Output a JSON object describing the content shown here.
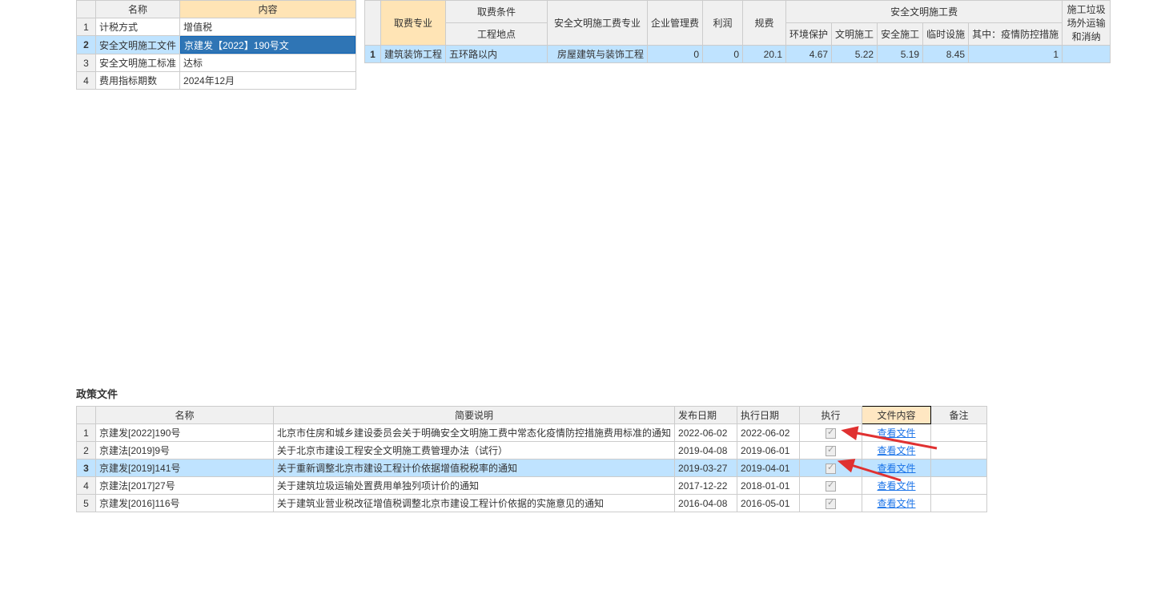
{
  "left_table": {
    "headers": {
      "name": "名称",
      "content": "内容"
    },
    "rows": [
      {
        "idx": "1",
        "name": "计税方式",
        "content": "增值税"
      },
      {
        "idx": "2",
        "name": "安全文明施工文件",
        "content": "京建发【2022】190号文",
        "selected": true,
        "editing": true
      },
      {
        "idx": "3",
        "name": "安全文明施工标准",
        "content": "达标"
      },
      {
        "idx": "4",
        "name": "费用指标期数",
        "content": "2024年12月"
      }
    ]
  },
  "right_table": {
    "headers": {
      "group_safety": "安全文明施工费",
      "fee_major": "取费专业",
      "fee_cond": "取费条件",
      "safety_major": "安全文明施工费专业",
      "ent_mgmt": "企业管理费",
      "profit": "利润",
      "regfee": "规费",
      "env": "环境保护",
      "civil": "文明施工",
      "safe": "安全施工",
      "temp": "临时设施",
      "pandemic": "其中：疫情防控措施",
      "garbage": "施工垃圾场外运输和消纳",
      "proj_loc": "工程地点"
    },
    "rows": [
      {
        "idx": "1",
        "fee_major": "建筑装饰工程",
        "proj_loc": "五环路以内",
        "safety_major": "房屋建筑与装饰工程",
        "ent_mgmt": "0",
        "profit": "0",
        "regfee": "20.1",
        "env": "4.67",
        "civil": "5.22",
        "safe": "5.19",
        "temp": "8.45",
        "pandemic": "1"
      }
    ]
  },
  "policy": {
    "title": "政策文件",
    "headers": {
      "name": "名称",
      "desc": "简要说明",
      "pub": "发布日期",
      "eff": "执行日期",
      "exec": "执行",
      "file": "文件内容",
      "remark": "备注",
      "link": "查看文件"
    },
    "rows": [
      {
        "idx": "1",
        "name": "京建发[2022]190号",
        "desc": "北京市住房和城乡建设委员会关于明确安全文明施工费中常态化疫情防控措施费用标准的通知",
        "pub": "2022-06-02",
        "eff": "2022-06-02",
        "checked": true
      },
      {
        "idx": "2",
        "name": "京建法[2019]9号",
        "desc": "关于北京市建设工程安全文明施工费管理办法（试行）",
        "pub": "2019-04-08",
        "eff": "2019-06-01",
        "checked": true
      },
      {
        "idx": "3",
        "name": "京建发[2019]141号",
        "desc": "关于重新调整北京市建设工程计价依据增值税税率的通知",
        "pub": "2019-03-27",
        "eff": "2019-04-01",
        "checked": true,
        "selected": true
      },
      {
        "idx": "4",
        "name": "京建法[2017]27号",
        "desc": "关于建筑垃圾运输处置费用单独列项计价的通知",
        "pub": "2017-12-22",
        "eff": "2018-01-01",
        "checked": true
      },
      {
        "idx": "5",
        "name": "京建发[2016]116号",
        "desc": "关于建筑业营业税改征增值税调整北京市建设工程计价依据的实施意见的通知",
        "pub": "2016-04-08",
        "eff": "2016-05-01",
        "checked": true
      }
    ]
  }
}
